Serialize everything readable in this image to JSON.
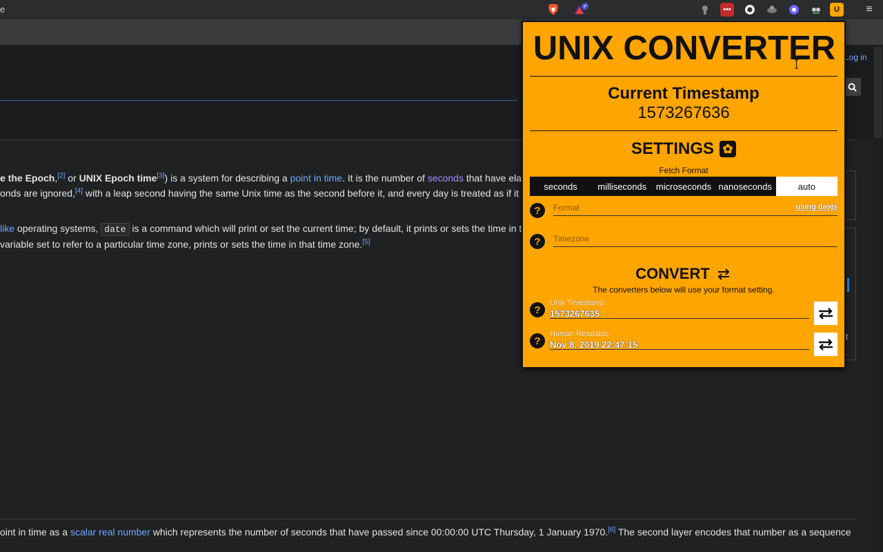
{
  "browser": {
    "tab_fragment": "e",
    "extensions": [
      "brave-icon",
      "bat-icon",
      "ext-icon-1",
      "lastpass-icon",
      "github-icon",
      "ext-icon-2",
      "ext-icon-3",
      "ext-icon-4",
      "unix-converter-icon"
    ],
    "menu_icon": "≡"
  },
  "wiki": {
    "login": "Log in",
    "p1_l1": [
      {
        "t": "e the Epoch",
        "s": "b"
      },
      {
        "t": ",",
        "s": ""
      },
      {
        "t": "[2]",
        "s": "sup"
      },
      {
        "t": " or ",
        "s": ""
      },
      {
        "t": "UNIX Epoch time",
        "s": "b"
      },
      {
        "t": "[3]",
        "s": "sup"
      },
      {
        "t": ") is a system for describing a ",
        "s": ""
      },
      {
        "t": "point in time",
        "s": "link"
      },
      {
        "t": ". It is the number of ",
        "s": ""
      },
      {
        "t": "seconds",
        "s": "vlink"
      },
      {
        "t": " that have elap",
        "s": ""
      }
    ],
    "p1_l2": [
      {
        "t": "onds are ignored,",
        "s": ""
      },
      {
        "t": "[4]",
        "s": "sup"
      },
      {
        "t": " with a leap second having the same Unix time as the second before it, and every day is treated as if it c",
        "s": ""
      }
    ],
    "p2_l1": [
      {
        "t": "like",
        "s": "link"
      },
      {
        "t": " operating systems, ",
        "s": ""
      },
      {
        "t": "date",
        "s": "code"
      },
      {
        "t": " is a command which will print or set the current time; by default, it prints or sets the time in t",
        "s": ""
      }
    ],
    "p2_l2": [
      {
        "t": "variable set to refer to a particular time zone, prints or sets the time in that time zone.",
        "s": ""
      },
      {
        "t": "[5]",
        "s": "sup"
      }
    ],
    "foot_l1": [
      {
        "t": "oint in time as a ",
        "s": ""
      },
      {
        "t": "scalar real number",
        "s": "link"
      },
      {
        "t": " which represents the number of seconds that have passed since 00:00:00 UTC Thursday, 1 January 1970.",
        "s": ""
      },
      {
        "t": "[6]",
        "s": "sup"
      },
      {
        "t": " The second layer encodes that number as a sequence",
        "s": ""
      }
    ],
    "side_fragment": "t"
  },
  "popup": {
    "title": "UNIX CONVERTER",
    "current_title": "Current Timestamp",
    "current_value": "1573267636",
    "settings_title": "SETTINGS",
    "fetch_format_label": "Fetch Format",
    "formats": [
      "seconds",
      "milliseconds",
      "microseconds",
      "nanoseconds",
      "auto"
    ],
    "selected_format": "auto",
    "format_placeholder": "Format",
    "format_hint": "using dayjs",
    "timezone_placeholder": "Timezone",
    "convert_title": "CONVERT",
    "convert_subtitle": "The converters below will use your format setting.",
    "unix_label": "Unix Timestamp",
    "unix_value": "1573267635",
    "human_label": "Human Readable",
    "human_value": "Nov 8, 2019 22:47:15",
    "help_glyph": "?",
    "colors": {
      "accent": "#ffa500",
      "dark": "#111111"
    }
  }
}
